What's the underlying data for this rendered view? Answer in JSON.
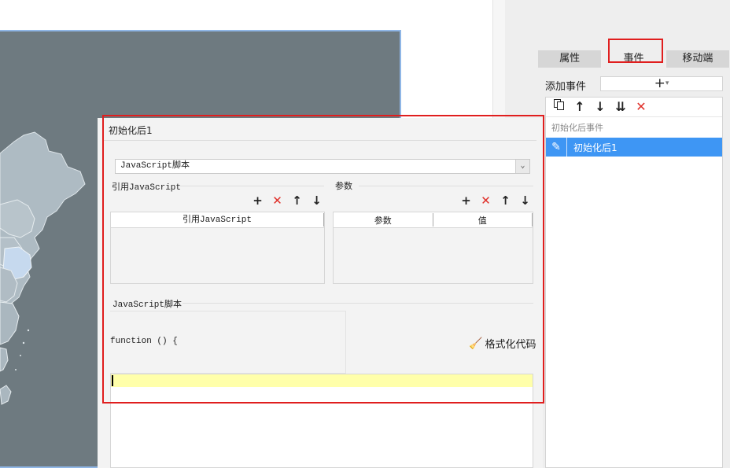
{
  "side_panel": {
    "tabs": [
      {
        "label": "属性",
        "active": false
      },
      {
        "label": "事件",
        "active": true
      },
      {
        "label": "移动端",
        "active": false
      }
    ],
    "add_event_label": "添加事件",
    "add_event_icon": "plus-icon",
    "toolbar_icons": [
      "copy-icon",
      "arrow-up-icon",
      "arrow-down-icon",
      "move-to-bottom-icon",
      "delete-icon"
    ],
    "event_group_label": "初始化后事件",
    "selected_event": "初始化后1"
  },
  "dialog": {
    "title": "初始化后1",
    "type_value": "JavaScript脚本",
    "ref_section_label": "引用JavaScript",
    "params_section_label": "参数",
    "ref_column": "引用JavaScript",
    "param_columns": [
      "参数",
      "值"
    ],
    "script_section_label": "JavaScript脚本",
    "function_signature": "function () {",
    "format_button_label": "格式化代码",
    "mini_toolbar_icons": [
      "plus-icon",
      "delete-icon",
      "arrow-up-icon",
      "arrow-down-icon"
    ]
  },
  "colors": {
    "highlight": "#e01e1e",
    "selected_row": "#3e96f4",
    "map_background": "#6e7a80",
    "code_line": "#ffffaa"
  }
}
